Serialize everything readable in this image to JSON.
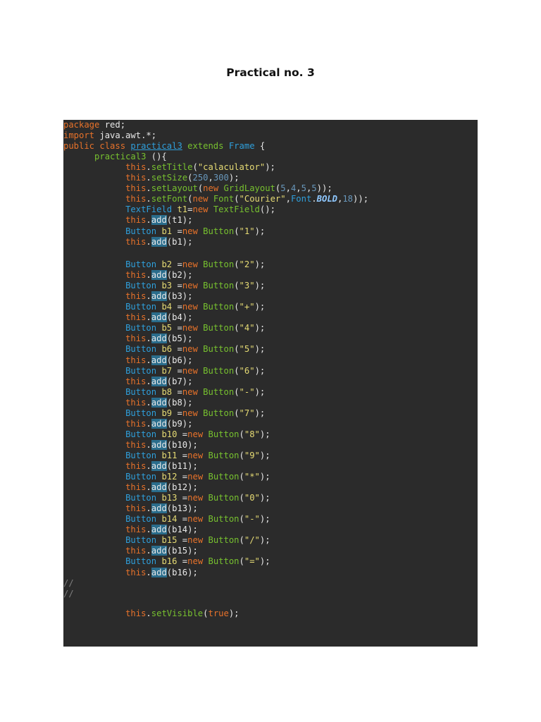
{
  "document": {
    "title": "Practical no. 3"
  },
  "code": {
    "lines": [
      [
        [
          "k",
          "package"
        ],
        [
          "w",
          " red;"
        ]
      ],
      [
        [
          "k",
          "import"
        ],
        [
          "w",
          " java.awt.*;"
        ]
      ],
      [
        [
          "k",
          "public"
        ],
        [
          "w",
          " "
        ],
        [
          "k",
          "class"
        ],
        [
          "w",
          " "
        ],
        [
          "u",
          "practical3"
        ],
        [
          "w",
          " "
        ],
        [
          "g",
          "extends"
        ],
        [
          "w",
          " "
        ],
        [
          "b",
          "Frame"
        ],
        [
          "w",
          " {"
        ]
      ],
      [
        [
          "w",
          "      "
        ],
        [
          "g",
          "practical3"
        ],
        [
          "w",
          " (){"
        ]
      ],
      [
        [
          "w",
          "            "
        ],
        [
          "k",
          "this"
        ],
        [
          "w",
          "."
        ],
        [
          "g",
          "setTitle"
        ],
        [
          "w",
          "("
        ],
        [
          "y",
          "\"calaculator\""
        ],
        [
          "w",
          ");"
        ]
      ],
      [
        [
          "w",
          "            "
        ],
        [
          "k",
          "this"
        ],
        [
          "w",
          "."
        ],
        [
          "g",
          "setSize"
        ],
        [
          "w",
          "("
        ],
        [
          "n",
          "250"
        ],
        [
          "w",
          ","
        ],
        [
          "n",
          "300"
        ],
        [
          "w",
          ");"
        ]
      ],
      [
        [
          "w",
          "            "
        ],
        [
          "k",
          "this"
        ],
        [
          "w",
          "."
        ],
        [
          "g",
          "setLayout"
        ],
        [
          "w",
          "("
        ],
        [
          "k",
          "new"
        ],
        [
          "w",
          " "
        ],
        [
          "g",
          "GridLayout"
        ],
        [
          "w",
          "("
        ],
        [
          "n",
          "5"
        ],
        [
          "w",
          ","
        ],
        [
          "n",
          "4"
        ],
        [
          "w",
          ","
        ],
        [
          "n",
          "5"
        ],
        [
          "w",
          ","
        ],
        [
          "n",
          "5"
        ],
        [
          "w",
          "));"
        ]
      ],
      [
        [
          "w",
          "            "
        ],
        [
          "k",
          "this"
        ],
        [
          "w",
          "."
        ],
        [
          "g",
          "setFont"
        ],
        [
          "w",
          "("
        ],
        [
          "k",
          "new"
        ],
        [
          "w",
          " "
        ],
        [
          "g",
          "Font"
        ],
        [
          "w",
          "("
        ],
        [
          "y",
          "\"Courier\""
        ],
        [
          "w",
          ","
        ],
        [
          "b",
          "Font"
        ],
        [
          "w",
          "."
        ],
        [
          "bi",
          "BOLD"
        ],
        [
          "w",
          ","
        ],
        [
          "n",
          "18"
        ],
        [
          "w",
          "));"
        ]
      ],
      [
        [
          "w",
          "            "
        ],
        [
          "b",
          "TextField"
        ],
        [
          "w",
          " "
        ],
        [
          "y",
          "t1"
        ],
        [
          "w",
          "="
        ],
        [
          "k",
          "new"
        ],
        [
          "w",
          " "
        ],
        [
          "g",
          "TextField"
        ],
        [
          "w",
          "();"
        ]
      ],
      [
        [
          "w",
          "            "
        ],
        [
          "k",
          "this"
        ],
        [
          "w",
          "."
        ],
        [
          "h",
          "add"
        ],
        [
          "w",
          "(t1);"
        ]
      ],
      [
        [
          "w",
          "            "
        ],
        [
          "b",
          "Button"
        ],
        [
          "w",
          " "
        ],
        [
          "y",
          "b1"
        ],
        [
          "w",
          " ="
        ],
        [
          "k",
          "new"
        ],
        [
          "w",
          " "
        ],
        [
          "g",
          "Button"
        ],
        [
          "w",
          "("
        ],
        [
          "y",
          "\"1\""
        ],
        [
          "w",
          ");"
        ]
      ],
      [
        [
          "w",
          "            "
        ],
        [
          "k",
          "this"
        ],
        [
          "w",
          "."
        ],
        [
          "h",
          "add"
        ],
        [
          "w",
          "(b1);"
        ]
      ],
      [],
      [
        [
          "w",
          "            "
        ],
        [
          "b",
          "Button"
        ],
        [
          "w",
          " "
        ],
        [
          "y",
          "b2"
        ],
        [
          "w",
          " ="
        ],
        [
          "k",
          "new"
        ],
        [
          "w",
          " "
        ],
        [
          "g",
          "Button"
        ],
        [
          "w",
          "("
        ],
        [
          "y",
          "\"2\""
        ],
        [
          "w",
          ");"
        ]
      ],
      [
        [
          "w",
          "            "
        ],
        [
          "k",
          "this"
        ],
        [
          "w",
          "."
        ],
        [
          "h",
          "add"
        ],
        [
          "w",
          "(b2);"
        ]
      ],
      [
        [
          "w",
          "            "
        ],
        [
          "b",
          "Button"
        ],
        [
          "w",
          " "
        ],
        [
          "y",
          "b3"
        ],
        [
          "w",
          " ="
        ],
        [
          "k",
          "new"
        ],
        [
          "w",
          " "
        ],
        [
          "g",
          "Button"
        ],
        [
          "w",
          "("
        ],
        [
          "y",
          "\"3\""
        ],
        [
          "w",
          ");"
        ]
      ],
      [
        [
          "w",
          "            "
        ],
        [
          "k",
          "this"
        ],
        [
          "w",
          "."
        ],
        [
          "h",
          "add"
        ],
        [
          "w",
          "(b3);"
        ]
      ],
      [
        [
          "w",
          "            "
        ],
        [
          "b",
          "Button"
        ],
        [
          "w",
          " "
        ],
        [
          "y",
          "b4"
        ],
        [
          "w",
          " ="
        ],
        [
          "k",
          "new"
        ],
        [
          "w",
          " "
        ],
        [
          "g",
          "Button"
        ],
        [
          "w",
          "("
        ],
        [
          "y",
          "\"+\""
        ],
        [
          "w",
          ");"
        ]
      ],
      [
        [
          "w",
          "            "
        ],
        [
          "k",
          "this"
        ],
        [
          "w",
          "."
        ],
        [
          "h",
          "add"
        ],
        [
          "w",
          "(b4);"
        ]
      ],
      [
        [
          "w",
          "            "
        ],
        [
          "b",
          "Button"
        ],
        [
          "w",
          " "
        ],
        [
          "y",
          "b5"
        ],
        [
          "w",
          " ="
        ],
        [
          "k",
          "new"
        ],
        [
          "w",
          " "
        ],
        [
          "g",
          "Button"
        ],
        [
          "w",
          "("
        ],
        [
          "y",
          "\"4\""
        ],
        [
          "w",
          ");"
        ]
      ],
      [
        [
          "w",
          "            "
        ],
        [
          "k",
          "this"
        ],
        [
          "w",
          "."
        ],
        [
          "h",
          "add"
        ],
        [
          "w",
          "(b5);"
        ]
      ],
      [
        [
          "w",
          "            "
        ],
        [
          "b",
          "Button"
        ],
        [
          "w",
          " "
        ],
        [
          "y",
          "b6"
        ],
        [
          "w",
          " ="
        ],
        [
          "k",
          "new"
        ],
        [
          "w",
          " "
        ],
        [
          "g",
          "Button"
        ],
        [
          "w",
          "("
        ],
        [
          "y",
          "\"5\""
        ],
        [
          "w",
          ");"
        ]
      ],
      [
        [
          "w",
          "            "
        ],
        [
          "k",
          "this"
        ],
        [
          "w",
          "."
        ],
        [
          "h",
          "add"
        ],
        [
          "w",
          "(b6);"
        ]
      ],
      [
        [
          "w",
          "            "
        ],
        [
          "b",
          "Button"
        ],
        [
          "w",
          " "
        ],
        [
          "y",
          "b7"
        ],
        [
          "w",
          " ="
        ],
        [
          "k",
          "new"
        ],
        [
          "w",
          " "
        ],
        [
          "g",
          "Button"
        ],
        [
          "w",
          "("
        ],
        [
          "y",
          "\"6\""
        ],
        [
          "w",
          ");"
        ]
      ],
      [
        [
          "w",
          "            "
        ],
        [
          "k",
          "this"
        ],
        [
          "w",
          "."
        ],
        [
          "h",
          "add"
        ],
        [
          "w",
          "(b7);"
        ]
      ],
      [
        [
          "w",
          "            "
        ],
        [
          "b",
          "Button"
        ],
        [
          "w",
          " "
        ],
        [
          "y",
          "b8"
        ],
        [
          "w",
          " ="
        ],
        [
          "k",
          "new"
        ],
        [
          "w",
          " "
        ],
        [
          "g",
          "Button"
        ],
        [
          "w",
          "("
        ],
        [
          "y",
          "\"-\""
        ],
        [
          "w",
          ");"
        ]
      ],
      [
        [
          "w",
          "            "
        ],
        [
          "k",
          "this"
        ],
        [
          "w",
          "."
        ],
        [
          "h",
          "add"
        ],
        [
          "w",
          "(b8);"
        ]
      ],
      [
        [
          "w",
          "            "
        ],
        [
          "b",
          "Button"
        ],
        [
          "w",
          " "
        ],
        [
          "y",
          "b9"
        ],
        [
          "w",
          " ="
        ],
        [
          "k",
          "new"
        ],
        [
          "w",
          " "
        ],
        [
          "g",
          "Button"
        ],
        [
          "w",
          "("
        ],
        [
          "y",
          "\"7\""
        ],
        [
          "w",
          ");"
        ]
      ],
      [
        [
          "w",
          "            "
        ],
        [
          "k",
          "this"
        ],
        [
          "w",
          "."
        ],
        [
          "h",
          "add"
        ],
        [
          "w",
          "(b9);"
        ]
      ],
      [
        [
          "w",
          "            "
        ],
        [
          "b",
          "Button"
        ],
        [
          "w",
          " "
        ],
        [
          "y",
          "b10"
        ],
        [
          "w",
          " ="
        ],
        [
          "k",
          "new"
        ],
        [
          "w",
          " "
        ],
        [
          "g",
          "Button"
        ],
        [
          "w",
          "("
        ],
        [
          "y",
          "\"8\""
        ],
        [
          "w",
          ");"
        ]
      ],
      [
        [
          "w",
          "            "
        ],
        [
          "k",
          "this"
        ],
        [
          "w",
          "."
        ],
        [
          "h",
          "add"
        ],
        [
          "w",
          "(b10);"
        ]
      ],
      [
        [
          "w",
          "            "
        ],
        [
          "b",
          "Button"
        ],
        [
          "w",
          " "
        ],
        [
          "y",
          "b11"
        ],
        [
          "w",
          " ="
        ],
        [
          "k",
          "new"
        ],
        [
          "w",
          " "
        ],
        [
          "g",
          "Button"
        ],
        [
          "w",
          "("
        ],
        [
          "y",
          "\"9\""
        ],
        [
          "w",
          ");"
        ]
      ],
      [
        [
          "w",
          "            "
        ],
        [
          "k",
          "this"
        ],
        [
          "w",
          "."
        ],
        [
          "h",
          "add"
        ],
        [
          "w",
          "(b11);"
        ]
      ],
      [
        [
          "w",
          "            "
        ],
        [
          "b",
          "Button"
        ],
        [
          "w",
          " "
        ],
        [
          "y",
          "b12"
        ],
        [
          "w",
          " ="
        ],
        [
          "k",
          "new"
        ],
        [
          "w",
          " "
        ],
        [
          "g",
          "Button"
        ],
        [
          "w",
          "("
        ],
        [
          "y",
          "\"*\""
        ],
        [
          "w",
          ");"
        ]
      ],
      [
        [
          "w",
          "            "
        ],
        [
          "k",
          "this"
        ],
        [
          "w",
          "."
        ],
        [
          "h",
          "add"
        ],
        [
          "w",
          "(b12);"
        ]
      ],
      [
        [
          "w",
          "            "
        ],
        [
          "b",
          "Button"
        ],
        [
          "w",
          " "
        ],
        [
          "y",
          "b13"
        ],
        [
          "w",
          " ="
        ],
        [
          "k",
          "new"
        ],
        [
          "w",
          " "
        ],
        [
          "g",
          "Button"
        ],
        [
          "w",
          "("
        ],
        [
          "y",
          "\"0\""
        ],
        [
          "w",
          ");"
        ]
      ],
      [
        [
          "w",
          "            "
        ],
        [
          "k",
          "this"
        ],
        [
          "w",
          "."
        ],
        [
          "h",
          "add"
        ],
        [
          "w",
          "(b13);"
        ]
      ],
      [
        [
          "w",
          "            "
        ],
        [
          "b",
          "Button"
        ],
        [
          "w",
          " "
        ],
        [
          "y",
          "b14"
        ],
        [
          "w",
          " ="
        ],
        [
          "k",
          "new"
        ],
        [
          "w",
          " "
        ],
        [
          "g",
          "Button"
        ],
        [
          "w",
          "("
        ],
        [
          "y",
          "\"-\""
        ],
        [
          "w",
          ");"
        ]
      ],
      [
        [
          "w",
          "            "
        ],
        [
          "k",
          "this"
        ],
        [
          "w",
          "."
        ],
        [
          "h",
          "add"
        ],
        [
          "w",
          "(b14);"
        ]
      ],
      [
        [
          "w",
          "            "
        ],
        [
          "b",
          "Button"
        ],
        [
          "w",
          " "
        ],
        [
          "y",
          "b15"
        ],
        [
          "w",
          " ="
        ],
        [
          "k",
          "new"
        ],
        [
          "w",
          " "
        ],
        [
          "g",
          "Button"
        ],
        [
          "w",
          "("
        ],
        [
          "y",
          "\"/\""
        ],
        [
          "w",
          ");"
        ]
      ],
      [
        [
          "w",
          "            "
        ],
        [
          "k",
          "this"
        ],
        [
          "w",
          "."
        ],
        [
          "h",
          "add"
        ],
        [
          "w",
          "(b15);"
        ]
      ],
      [
        [
          "w",
          "            "
        ],
        [
          "b",
          "Button"
        ],
        [
          "w",
          " "
        ],
        [
          "y",
          "b16"
        ],
        [
          "w",
          " ="
        ],
        [
          "k",
          "new"
        ],
        [
          "w",
          " "
        ],
        [
          "g",
          "Button"
        ],
        [
          "w",
          "("
        ],
        [
          "y",
          "\"=\""
        ],
        [
          "w",
          ");"
        ]
      ],
      [
        [
          "w",
          "            "
        ],
        [
          "k",
          "this"
        ],
        [
          "w",
          "."
        ],
        [
          "h",
          "add"
        ],
        [
          "w",
          "(b16);"
        ]
      ],
      [
        [
          "c",
          "//"
        ]
      ],
      [
        [
          "c",
          "//"
        ]
      ],
      [],
      [
        [
          "w",
          "            "
        ],
        [
          "k",
          "this"
        ],
        [
          "w",
          "."
        ],
        [
          "g",
          "setVisible"
        ],
        [
          "w",
          "("
        ],
        [
          "k",
          "true"
        ],
        [
          "w",
          ");"
        ]
      ],
      [],
      [],
      [],
      [
        [
          "w",
          "                  }"
        ]
      ]
    ]
  }
}
